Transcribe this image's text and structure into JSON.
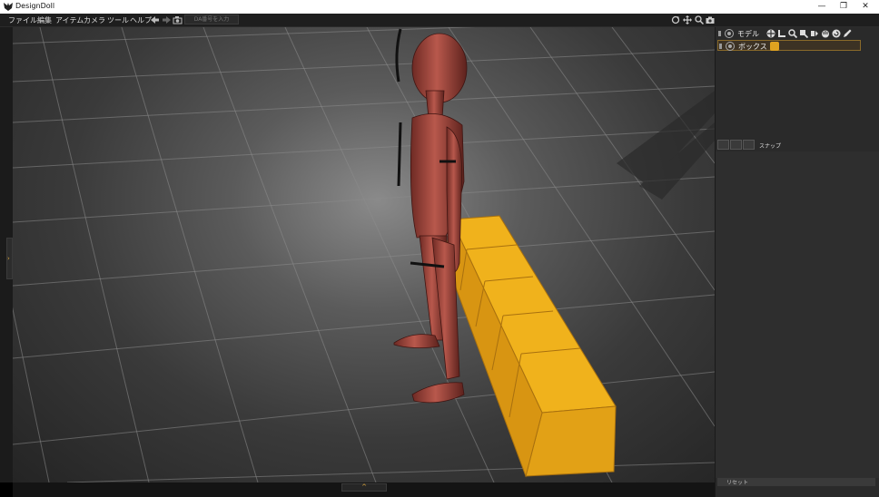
{
  "window": {
    "title": "DesignDoll",
    "minimize": "—",
    "maximize": "❐",
    "close": "✕"
  },
  "menu": [
    "ファイル",
    "編集",
    "アイテム",
    "カメラ",
    "ツール",
    "ヘルプ"
  ],
  "toolbar": {
    "undo_icon": "arrow-left-icon",
    "redo_icon": "arrow-right-icon",
    "camera_icon": "camera-icon",
    "search_placeholder": "DA番号を入力"
  },
  "view_tools": [
    "rotate-icon",
    "move-icon",
    "zoom-icon",
    "screenshot-icon"
  ],
  "panel": {
    "objects": [
      {
        "label": "モデル",
        "selected": false
      },
      {
        "label": "ボックス",
        "selected": true
      }
    ],
    "tool_icons": [
      "move-gizmo-icon",
      "bone-icon",
      "zoom-icon",
      "pin-icon",
      "mirror-icon",
      "hand-icon",
      "reset-icon",
      "pen-icon"
    ],
    "tab_label": "スナップ",
    "reset_label": "リセット"
  },
  "expand_left": "›",
  "expand_bottom": "^",
  "colors": {
    "accent": "#e0a320",
    "box": "#e7a516",
    "doll": "#a4453c",
    "panel_bg": "#2a2a2a"
  }
}
